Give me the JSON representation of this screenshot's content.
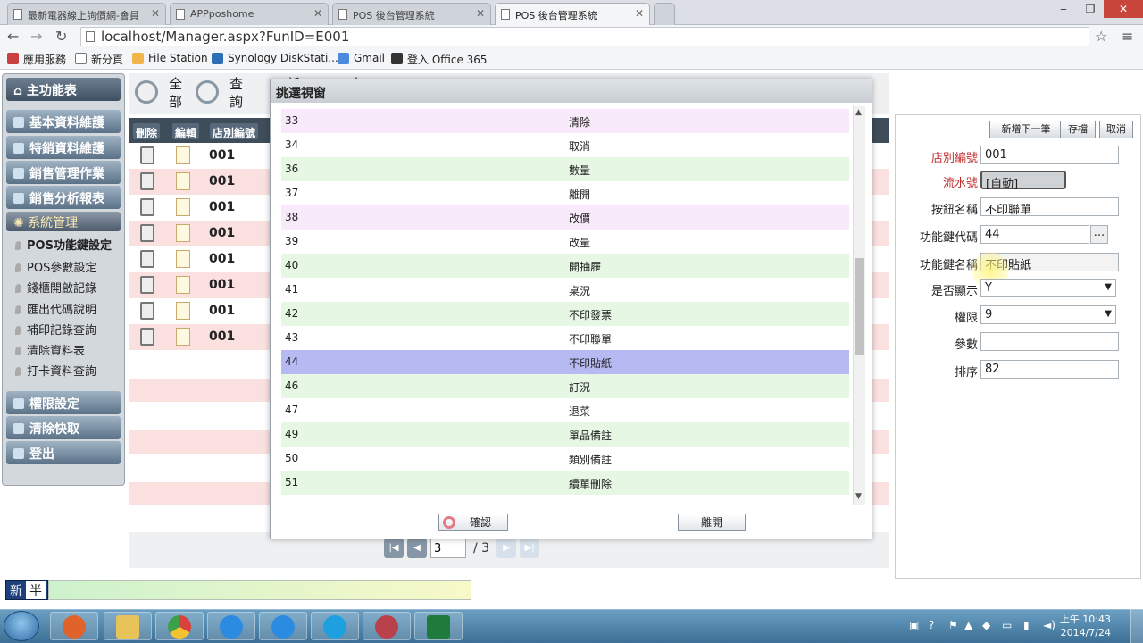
{
  "browser": {
    "tabs": [
      {
        "label": "最新電器線上詢價網-會員"
      },
      {
        "label": "APPposhome"
      },
      {
        "label": "POS 後台管理系統"
      },
      {
        "label": "POS 後台管理系統"
      }
    ],
    "url": "localhost/Manager.aspx?FunID=E001",
    "bookmarks": [
      {
        "label": "應用服務",
        "icon": "apps-grid-icon",
        "color": "#c94040"
      },
      {
        "label": "新分頁",
        "icon": "page-icon",
        "color": "#ffffff"
      },
      {
        "label": "File Station",
        "icon": "folder-icon",
        "color": "#f1b64a"
      },
      {
        "label": "Synology DiskStati...",
        "icon": "dsm-icon",
        "color": "#2d6fb5"
      },
      {
        "label": "Gmail",
        "icon": "google-icon",
        "color": "#4a8be0"
      },
      {
        "label": "登入 Office 365",
        "icon": "office-icon",
        "color": "#333333"
      }
    ]
  },
  "menu": {
    "home": "主功能表",
    "categories": [
      "基本資料維護",
      "特銷資料維護",
      "銷售管理作業",
      "銷售分析報表"
    ],
    "system": "系統管理",
    "sub_items": [
      "POS功能鍵設定",
      "POS參數設定",
      "錢櫃開啟記錄",
      "匯出代碼說明",
      "補印記錄查詢",
      "清除資料表",
      "打卡資料查詢"
    ],
    "bottom": [
      "權限設定",
      "清除快取",
      "登出"
    ]
  },
  "toolbar": {
    "all": "全部",
    "query": "查詢",
    "add": "新增",
    "save": "存檔"
  },
  "grid": {
    "headers": [
      "刪除",
      "編輯",
      "店別編號"
    ],
    "rows": [
      {
        "store": "001"
      },
      {
        "store": "001"
      },
      {
        "store": "001"
      },
      {
        "store": "001"
      },
      {
        "store": "001"
      },
      {
        "store": "001"
      },
      {
        "store": "001"
      },
      {
        "store": "001"
      }
    ]
  },
  "pager": {
    "current": "3",
    "total": "/ 3"
  },
  "form": {
    "buttons": {
      "add_next": "新增下一筆",
      "save": "存檔",
      "cancel": "取消"
    },
    "fields": [
      {
        "label": "店別編號",
        "value": "001",
        "required": true
      },
      {
        "label": "流水號",
        "value": "[自動]",
        "required": true
      },
      {
        "label": "按鈕名稱",
        "value": "不印聯單"
      },
      {
        "label": "功能鍵代碼",
        "value": "44"
      },
      {
        "label": "功能鍵名稱",
        "value": "不印貼紙"
      },
      {
        "label": "是否顯示",
        "value": "Y"
      },
      {
        "label": "權限",
        "value": "9"
      },
      {
        "label": "參數",
        "value": ""
      },
      {
        "label": "排序",
        "value": "82"
      }
    ],
    "lookup_button": "..."
  },
  "modal": {
    "title": "挑選視窗",
    "items": [
      {
        "code": "33",
        "name": "清除"
      },
      {
        "code": "34",
        "name": "取消"
      },
      {
        "code": "36",
        "name": "數量"
      },
      {
        "code": "37",
        "name": "離開"
      },
      {
        "code": "38",
        "name": "改價"
      },
      {
        "code": "39",
        "name": "改量"
      },
      {
        "code": "40",
        "name": "開抽屜"
      },
      {
        "code": "41",
        "name": "桌況"
      },
      {
        "code": "42",
        "name": "不印發票"
      },
      {
        "code": "43",
        "name": "不印聯單"
      },
      {
        "code": "44",
        "name": "不印貼紙"
      },
      {
        "code": "46",
        "name": "訂況"
      },
      {
        "code": "47",
        "name": "退菜"
      },
      {
        "code": "49",
        "name": "單品備註"
      },
      {
        "code": "50",
        "name": "類別備註"
      },
      {
        "code": "51",
        "name": "續單刪除"
      }
    ],
    "selected_code": "44",
    "confirm": "確認",
    "leave": "離開"
  },
  "ime": {
    "lang": "新",
    "mode": "半"
  },
  "taskbar": {
    "apps": [
      {
        "icon": "media-player-icon",
        "color": "#e0632a"
      },
      {
        "icon": "file-explorer-icon",
        "color": "#e8c35a"
      },
      {
        "icon": "chrome-icon",
        "color": "#d8423a"
      },
      {
        "icon": "internet-explorer-icon",
        "color": "#2a8be0"
      },
      {
        "icon": "internet-explorer-icon",
        "color": "#2a8be0"
      },
      {
        "icon": "skype-icon",
        "color": "#1ea0e0"
      },
      {
        "icon": "speedometer-icon",
        "color": "#b9414b"
      },
      {
        "icon": "excel-icon",
        "color": "#1e7b3c"
      }
    ],
    "time": "上午 10:43",
    "date": "2014/7/24"
  }
}
